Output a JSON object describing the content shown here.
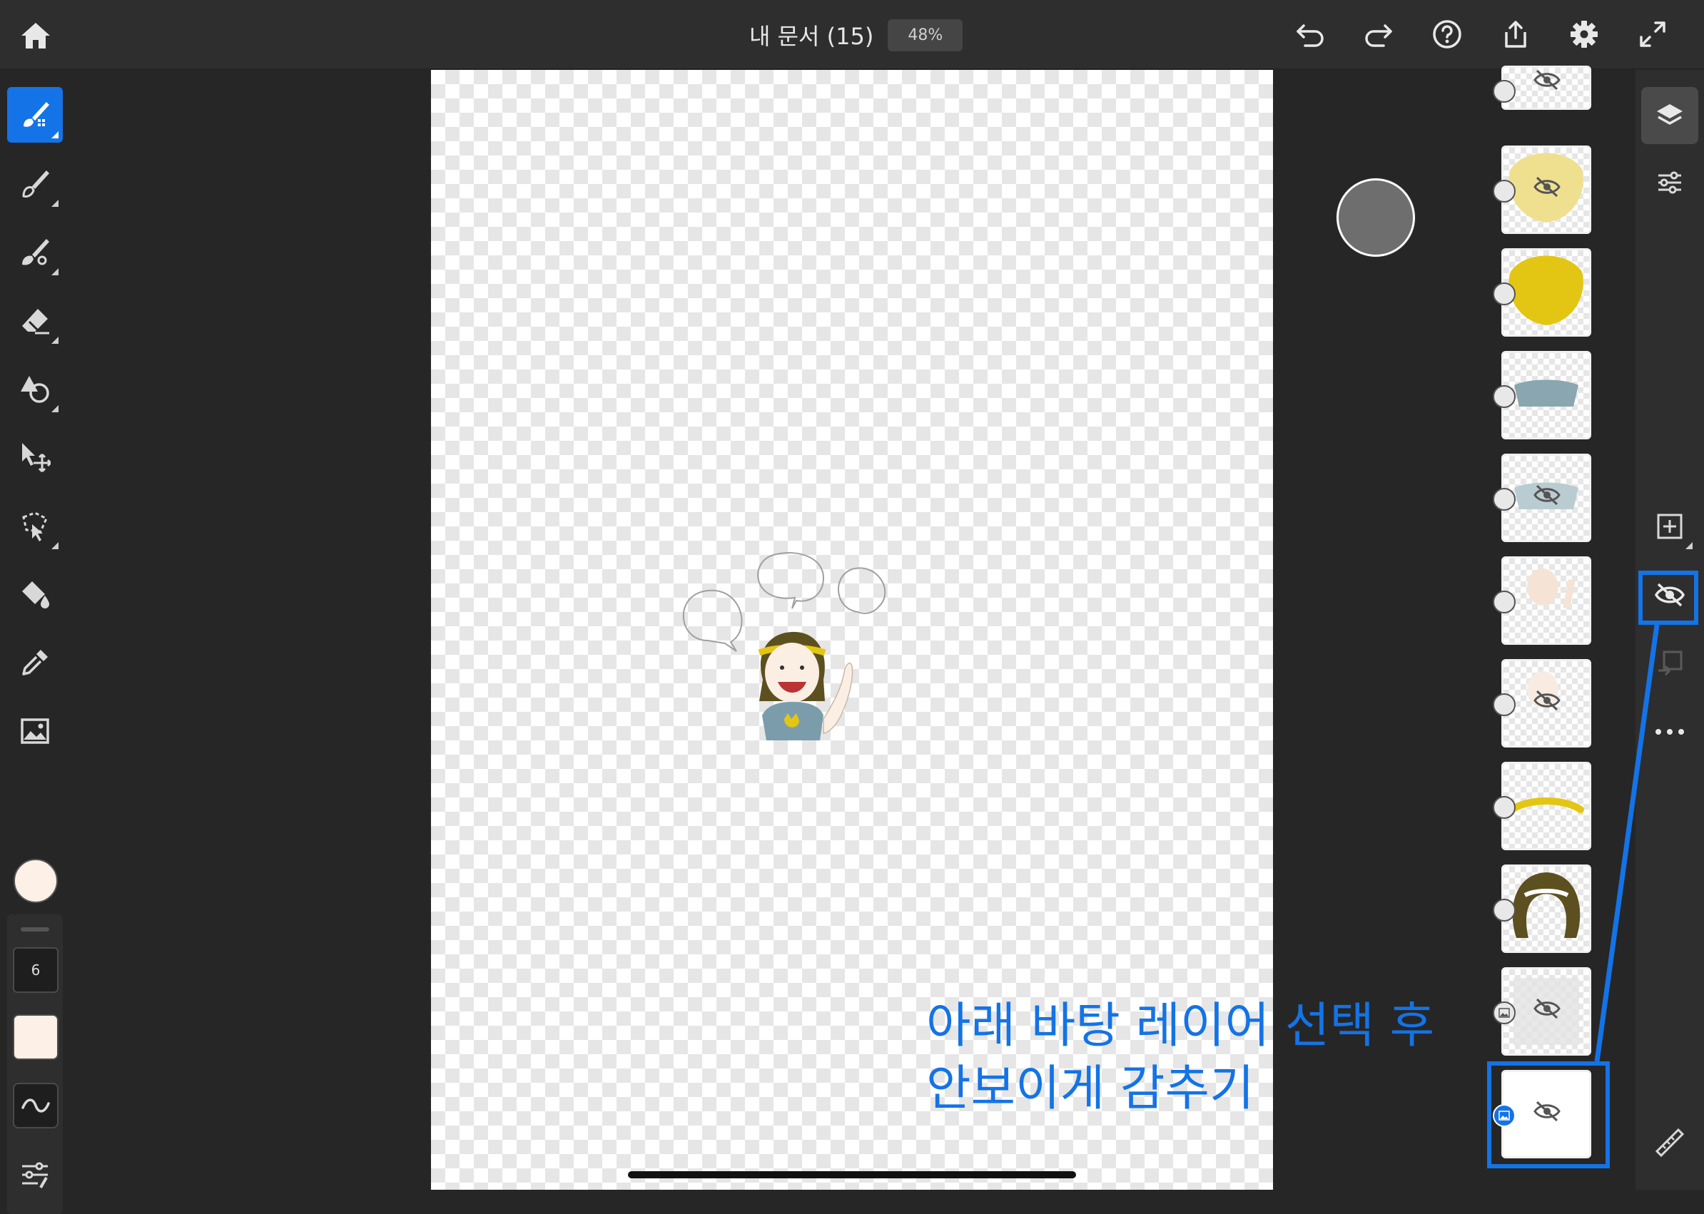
{
  "header": {
    "document_title": "내 문서 (15)",
    "zoom_level": "48%",
    "icons": [
      "home-icon",
      "undo-icon",
      "redo-icon",
      "help-icon",
      "share-icon",
      "gear-icon",
      "fullscreen-icon"
    ]
  },
  "left_toolbar": {
    "tools": [
      "pixel-brush-icon",
      "live-brush-icon",
      "vector-brush-icon",
      "eraser-icon",
      "shapes-icon",
      "transform-icon",
      "selection-icon",
      "fill-icon",
      "eyedropper-icon",
      "image-icon"
    ],
    "active_tool": "pixel-brush",
    "color": "#fdf0e6",
    "brush_size": "6"
  },
  "layers": {
    "count": 11,
    "selected_index": 10,
    "hidden_indices": [
      0,
      1,
      4,
      6,
      9,
      10
    ]
  },
  "right_rail": {
    "icons": [
      "layers-icon",
      "layer-properties-icon",
      "add-layer-icon",
      "hide-layer-icon",
      "merge-layer-icon",
      "more-icon",
      "ruler-icon"
    ]
  },
  "annotation": {
    "line1": "아래 바탕 레이어 선택 후",
    "line2": "안보이게 감추기",
    "color": "#1473e6"
  }
}
